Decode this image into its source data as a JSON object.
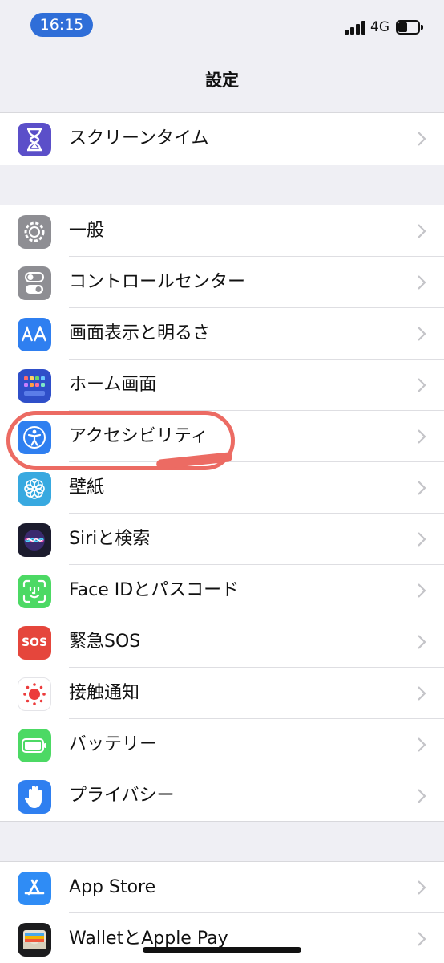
{
  "status": {
    "time": "16:15",
    "network": "4G"
  },
  "nav": {
    "title": "設定"
  },
  "groups": [
    {
      "items": [
        {
          "label": "スクリーンタイム",
          "icon": "hourglass-icon",
          "color": "#5b4fc9"
        }
      ]
    },
    {
      "items": [
        {
          "label": "一般",
          "icon": "gear-icon",
          "color": "#8e8e93"
        },
        {
          "label": "コントロールセンター",
          "icon": "toggles-icon",
          "color": "#8e8e93"
        },
        {
          "label": "画面表示と明るさ",
          "icon": "text-size-icon",
          "color": "#2f7ff0"
        },
        {
          "label": "ホーム画面",
          "icon": "app-grid-icon",
          "color": "#2f4fc9"
        },
        {
          "label": "アクセシビリティ",
          "icon": "accessibility-icon",
          "color": "#2f7ff0"
        },
        {
          "label": "壁紙",
          "icon": "flower-icon",
          "color": "#38a9e0"
        },
        {
          "label": "Siriと検索",
          "icon": "siri-icon",
          "color": "#1c1c2e"
        },
        {
          "label": "Face IDとパスコード",
          "icon": "face-id-icon",
          "color": "#4cd964"
        },
        {
          "label": "緊急SOS",
          "icon": "sos-icon",
          "color": "#e5463c"
        },
        {
          "label": "接触通知",
          "icon": "exposure-notification-icon",
          "color": "#ffffff"
        },
        {
          "label": "バッテリー",
          "icon": "battery-icon",
          "color": "#4cd964"
        },
        {
          "label": "プライバシー",
          "icon": "hand-icon",
          "color": "#2f7ff0"
        }
      ]
    },
    {
      "items": [
        {
          "label": "App Store",
          "icon": "app-store-icon",
          "color": "#2f8cf5"
        },
        {
          "label": "WalletとApple Pay",
          "icon": "wallet-icon",
          "color": "#1c1c1e"
        }
      ]
    }
  ],
  "sos_text": "SOS",
  "highlight_color": "#ec6b63"
}
